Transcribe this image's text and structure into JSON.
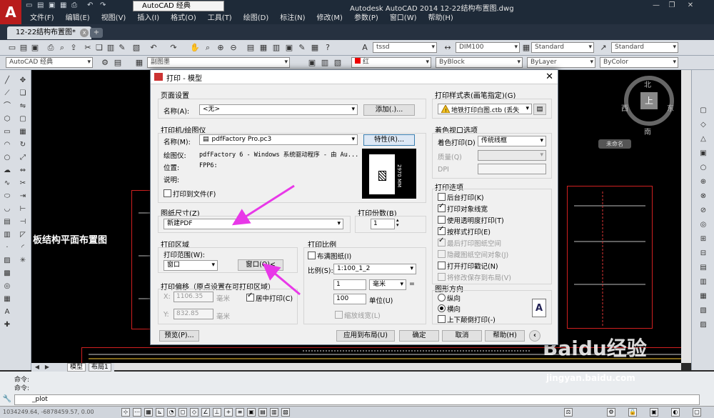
{
  "titlebar": {
    "logo": "A",
    "workspace": "AutoCAD 经典",
    "app_title": "Autodesk AutoCAD 2014    12-22结构布置图.dwg",
    "menu": [
      "文件(F)",
      "编辑(E)",
      "视图(V)",
      "插入(I)",
      "格式(O)",
      "工具(T)",
      "绘图(D)",
      "标注(N)",
      "修改(M)",
      "参数(P)",
      "窗口(W)",
      "帮助(H)"
    ]
  },
  "doc_tab": {
    "name": "12-22结构布置图*",
    "close": "x",
    "new": "+"
  },
  "toolbar2": {
    "workspace": "AutoCAD 经典",
    "layer": "副图墨",
    "text_style": "tssd",
    "dim_style": "DIM100",
    "table_style": "Standard",
    "mleader_style": "Standard",
    "color": "红",
    "linetype": "ByBlock",
    "lineweight": "ByLayer",
    "plotstyle": "ByColor"
  },
  "canvas": {
    "plan_title": "板结构平面布置图",
    "compass": {
      "n": "北",
      "s": "南",
      "w": "西",
      "e": "东",
      "center": "上"
    },
    "ucs_name": "未命名",
    "watermark": "Baidu经验",
    "watermark_url": "jingyan.baidu.com"
  },
  "layout_tabs": [
    "模型",
    "布局1"
  ],
  "command": {
    "history1": "命令:",
    "history2": "命令:",
    "input": "_plot",
    "coords": "1034249.64, -6878459.57, 0.00"
  },
  "dialog": {
    "title": "打印 - 模型",
    "page_setup": {
      "group": "页面设置",
      "name_label": "名称(A):",
      "name_value": "<无>",
      "add_btn": "添加(.)..."
    },
    "printer": {
      "group": "打印机/绘图仪",
      "name_label": "名称(M):",
      "name_value": "pdfFactory Pro.pc3",
      "props_btn": "特性(R)...",
      "plotter_label": "绘图仪:",
      "plotter_value": "pdfFactory 6 - Windows 系统驱动程序 - 由 Au...",
      "where_label": "位置:",
      "where_value": "FPP6:",
      "desc_label": "说明:",
      "to_file": "打印到文件(F)",
      "preview_dim": "2970 MM"
    },
    "paper": {
      "group": "图纸尺寸(Z)",
      "value": "新建PDF"
    },
    "copies": {
      "group": "打印份数(B)",
      "value": "1"
    },
    "area": {
      "group": "打印区域",
      "range_label": "打印范围(W):",
      "range_value": "窗口",
      "window_btn": "窗口(O)<"
    },
    "offset": {
      "group": "打印偏移（原点设置在可打印区域）",
      "x_label": "X:",
      "x_value": "1106.35",
      "x_unit": "毫米",
      "y_label": "Y:",
      "y_value": "832.85",
      "y_unit": "毫米",
      "center": "居中打印(C)"
    },
    "scale": {
      "group": "打印比例",
      "fit": "布满图纸(I)",
      "ratio_label": "比例(S):",
      "ratio_value": "1:100_1_2",
      "num": "1",
      "unit": "毫米",
      "eq": "=",
      "den": "100",
      "den_label": "单位(U)",
      "scale_lw": "缩放线宽(L)"
    },
    "preview_btn": "预览(P)...",
    "apply_btn": "应用到布局(U)",
    "ok_btn": "确定",
    "cancel_btn": "取消",
    "help_btn": "帮助(H)",
    "expand_icon": "‹",
    "style_table": {
      "group": "打印样式表(画笔指定)(G)",
      "value": "地铁打印白图.ctb (丢失"
    },
    "shaded": {
      "group": "着色视口选项",
      "shade_label": "着色打印(D)",
      "shade_value": "传统线框",
      "quality_label": "质量(Q)",
      "dpi_label": "DPI"
    },
    "options": {
      "group": "打印选项",
      "items": [
        {
          "label": "后台打印(K)",
          "checked": false,
          "disabled": false
        },
        {
          "label": "打印对象线宽",
          "checked": true,
          "disabled": false
        },
        {
          "label": "使用透明度打印(T)",
          "checked": false,
          "disabled": false
        },
        {
          "label": "按样式打印(E)",
          "checked": true,
          "disabled": false
        },
        {
          "label": "最后打印图纸空间",
          "checked": true,
          "disabled": true
        },
        {
          "label": "隐藏图纸空间对象(J)",
          "checked": false,
          "disabled": true
        },
        {
          "label": "打开打印戳记(N)",
          "checked": false,
          "disabled": false
        },
        {
          "label": "将修改保存到布局(V)",
          "checked": false,
          "disabled": true
        }
      ]
    },
    "orientation": {
      "group": "图形方向",
      "portrait": "纵向",
      "landscape": "横向",
      "upside": "上下颠倒打印(-)"
    }
  }
}
